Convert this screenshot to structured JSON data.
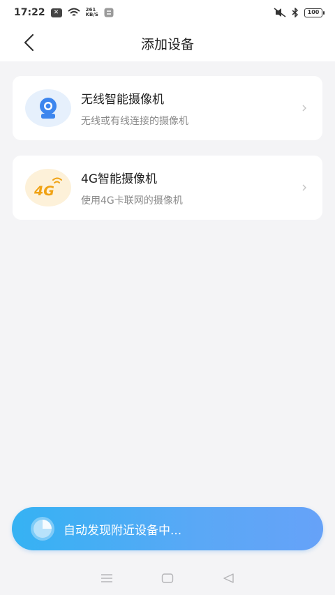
{
  "status_bar": {
    "time": "17:22",
    "net_speed_value": "261",
    "net_speed_unit": "KB/S",
    "battery": "100"
  },
  "header": {
    "title": "添加设备"
  },
  "devices": [
    {
      "title": "无线智能摄像机",
      "subtitle": "无线或有线连接的摄像机",
      "icon": "camera-icon",
      "icon_bg": "#e6f0fc",
      "icon_color": "#3d86ee"
    },
    {
      "title": "4G智能摄像机",
      "subtitle": "使用4G卡联网的摄像机",
      "icon": "4g-icon",
      "icon_label": "4G",
      "icon_bg": "#fdf1d9",
      "icon_color": "#f0a213"
    }
  ],
  "scan": {
    "label": "自动发现附近设备中..."
  },
  "colors": {
    "accent": "#3d9cf5",
    "background": "#f4f4f6"
  }
}
